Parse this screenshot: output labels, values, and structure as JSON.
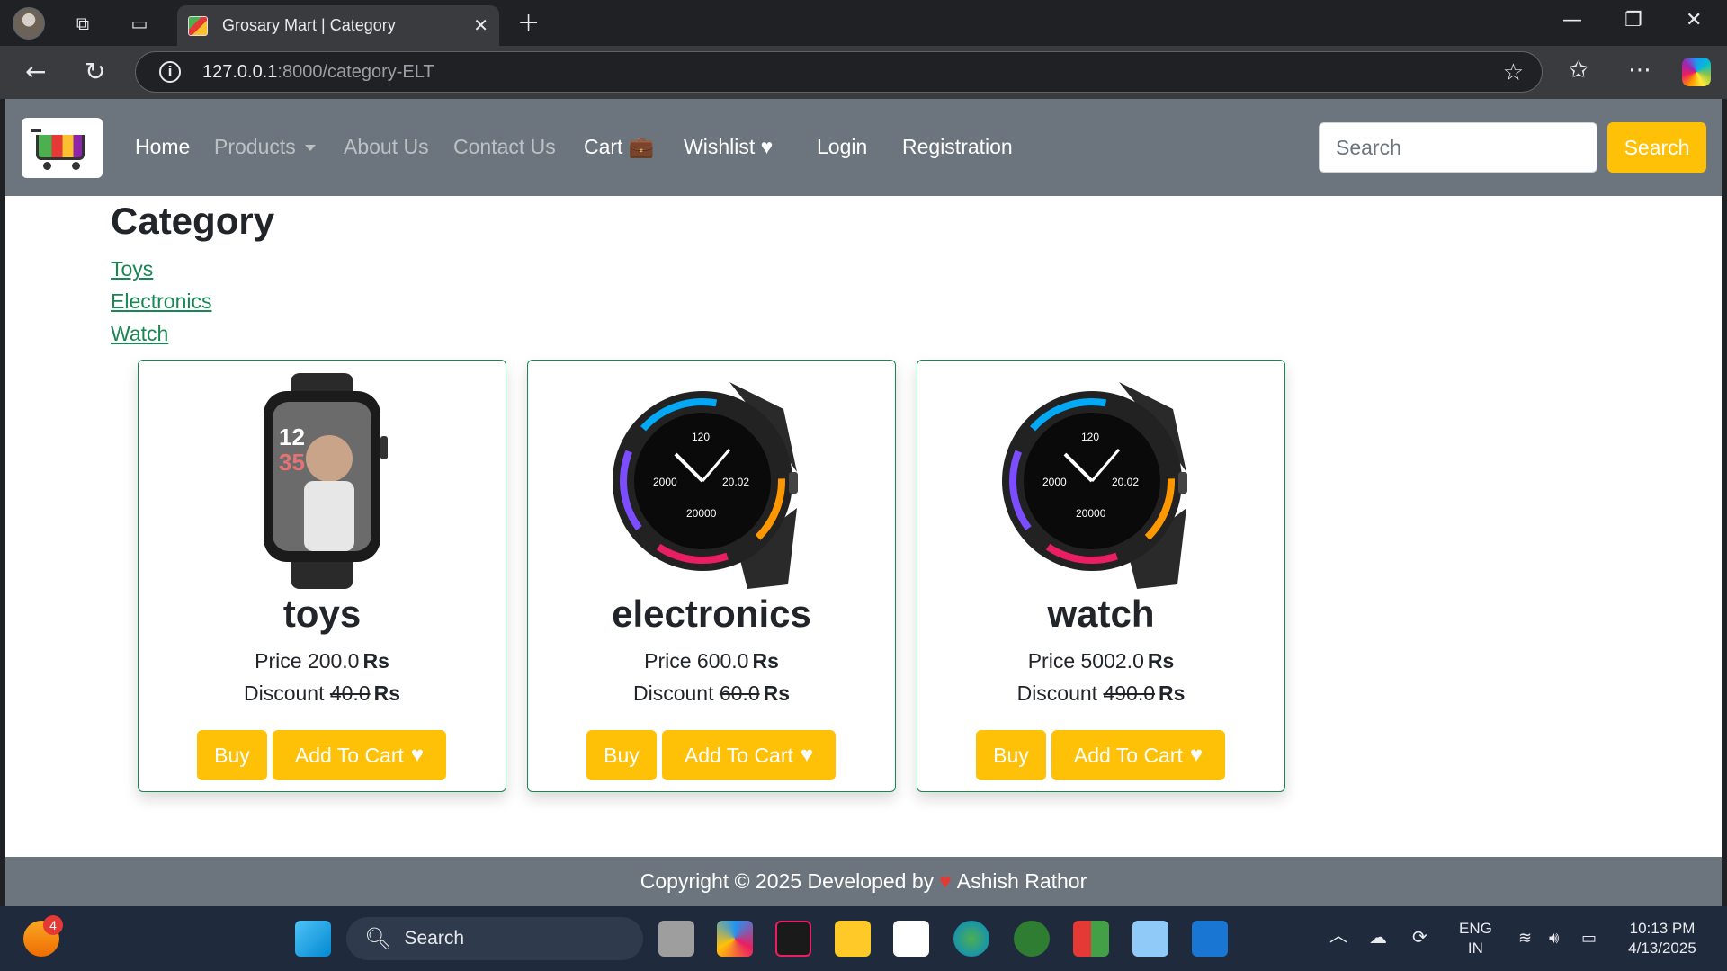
{
  "browser": {
    "tab_title": "Grosary Mart | Category",
    "url_host": "127.0.0.1",
    "url_path": ":8000/category-ELT"
  },
  "navbar": {
    "links": [
      "Home",
      "Products",
      "About Us",
      "Contact Us",
      "Cart",
      "Wishlist",
      "Login",
      "Registration"
    ],
    "search_placeholder": "Search",
    "search_button": "Search"
  },
  "main": {
    "heading": "Category",
    "categories": [
      "Toys",
      "Electronics",
      "Watch"
    ],
    "products": [
      {
        "title": "toys",
        "price_label": "Price",
        "price": "200.0",
        "discount_label": "Discount",
        "discount": "40.0",
        "currency": "Rs",
        "buy": "Buy",
        "add_to_cart": "Add To Cart"
      },
      {
        "title": "electronics",
        "price_label": "Price",
        "price": "600.0",
        "discount_label": "Discount",
        "discount": "60.0",
        "currency": "Rs",
        "buy": "Buy",
        "add_to_cart": "Add To Cart"
      },
      {
        "title": "watch",
        "price_label": "Price",
        "price": "5002.0",
        "discount_label": "Discount",
        "discount": "490.0",
        "currency": "Rs",
        "buy": "Buy",
        "add_to_cart": "Add To Cart"
      }
    ]
  },
  "footer": {
    "text_before": "Copyright © 2025 Developed by",
    "author": "Ashish Rathor"
  },
  "taskbar": {
    "search_label": "Search",
    "notification_count": "4",
    "lang_top": "ENG",
    "lang_bottom": "IN",
    "time": "10:13 PM",
    "date": "4/13/2025"
  },
  "colors": {
    "navbar": "#6c757d",
    "accent": "#ffc107",
    "link": "#198754"
  },
  "icons": [
    "back-icon",
    "refresh-icon",
    "info-icon",
    "star-icon",
    "favorites-icon",
    "more-icon",
    "briefcase-icon",
    "heart-icon",
    "windows-icon"
  ]
}
